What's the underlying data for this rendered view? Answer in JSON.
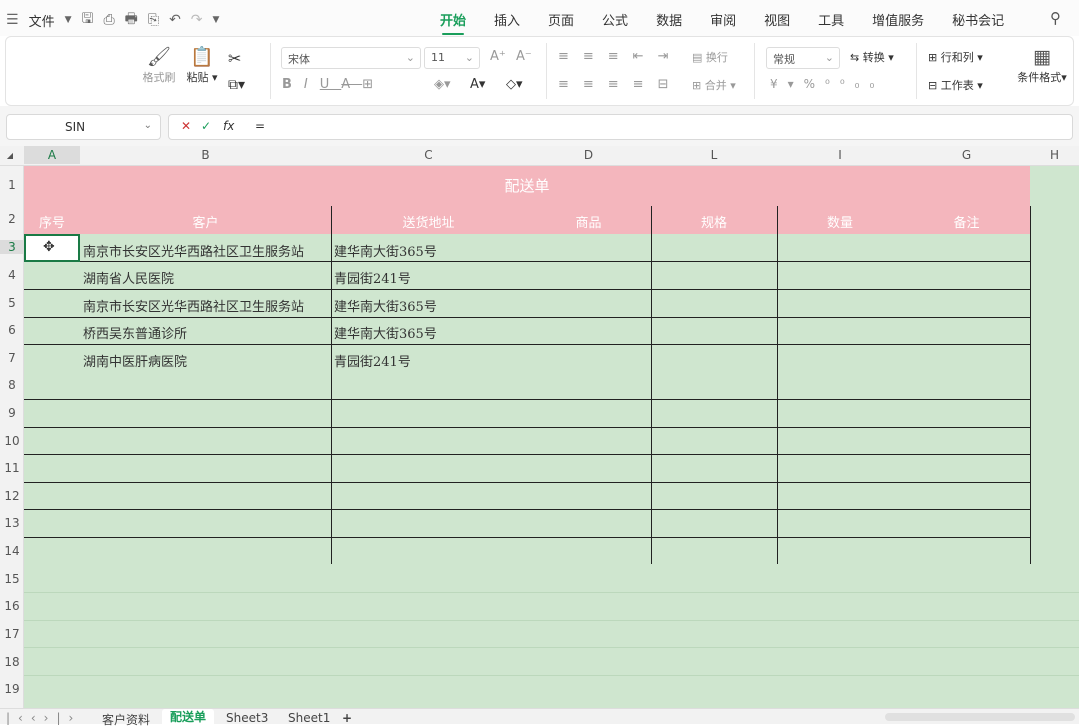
{
  "menubar": {
    "file_label": "文件",
    "tabs": [
      "开始",
      "插入",
      "页面",
      "公式",
      "数据",
      "审阅",
      "视图",
      "工具",
      "增值服务",
      "秘书会记"
    ]
  },
  "ribbon": {
    "format_painter": "格式刷",
    "paste": "粘贴",
    "font_name": "宋体",
    "font_size": "11",
    "wrap": "换行",
    "merge": "合并",
    "number_format": "常规",
    "convert": "转换",
    "rows_cols": "行和列",
    "worksheet": "工作表",
    "cond_format": "条件格式"
  },
  "formula_bar": {
    "name_box": "SIN",
    "fx": "fx",
    "content": "="
  },
  "columns": [
    "A",
    "B",
    "C",
    "D",
    "L",
    "I",
    "G",
    "H"
  ],
  "rows": [
    "1",
    "2",
    "3",
    "4",
    "5",
    "6",
    "7",
    "8",
    "9",
    "10",
    "11",
    "12",
    "13",
    "14",
    "15",
    "16",
    "17",
    "18",
    "19"
  ],
  "sheet": {
    "title": "配送单",
    "headers": [
      "序号",
      "客户",
      "送货地址",
      "商品",
      "规格",
      "数量",
      "备注"
    ],
    "data_rows": [
      {
        "customer": "南京市长安区光华西路社区卫生服务站",
        "address": "建华南大街365号"
      },
      {
        "customer": "湖南省人民医院",
        "address": "青园街241号"
      },
      {
        "customer": "南京市长安区光华西路社区卫生服务站",
        "address": "建华南大街365号"
      },
      {
        "customer": "桥西吴东普通诊所",
        "address": "建华南大街365号"
      },
      {
        "customer": "湖南中医肝病医院",
        "address": "青园街241号"
      }
    ]
  },
  "sheet_tabs": [
    "客户资料",
    "配送单",
    "Sheet3",
    "Sheet1"
  ],
  "active_sheet": "配送单",
  "colors": {
    "accent": "#1a9e5b",
    "header_pink": "#f4b6bd",
    "cell_green": "#cfe6cf"
  }
}
